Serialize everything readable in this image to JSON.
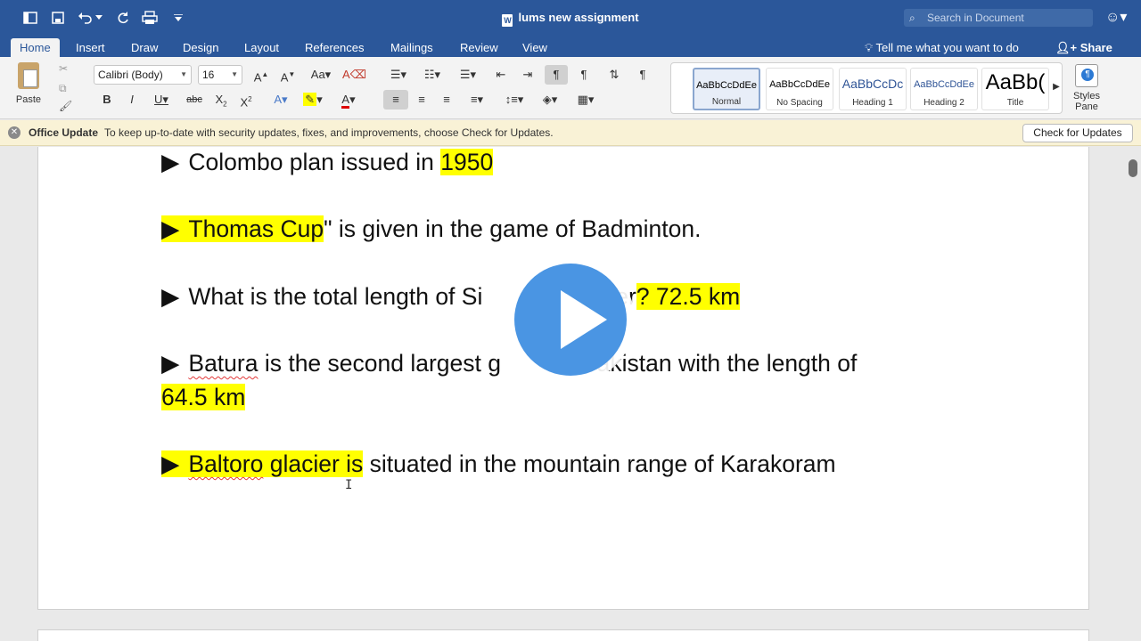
{
  "window": {
    "title": "lums new assignment",
    "search_placeholder": "Search in Document"
  },
  "tabs": [
    {
      "label": "Home"
    },
    {
      "label": "Insert"
    },
    {
      "label": "Draw"
    },
    {
      "label": "Design"
    },
    {
      "label": "Layout"
    },
    {
      "label": "References"
    },
    {
      "label": "Mailings"
    },
    {
      "label": "Review"
    },
    {
      "label": "View"
    }
  ],
  "tell_me": "Tell me what you want to do",
  "share_label": "Share",
  "ribbon": {
    "paste_label": "Paste",
    "font_name": "Calibri (Body)",
    "font_size": "16",
    "styles": [
      {
        "preview": "AaBbCcDdEe",
        "name": "Normal"
      },
      {
        "preview": "AaBbCcDdEe",
        "name": "No Spacing"
      },
      {
        "preview": "AaBbCcDc",
        "name": "Heading 1"
      },
      {
        "preview": "AaBbCcDdEe",
        "name": "Heading 2"
      },
      {
        "preview": "AaBb(",
        "name": "Title"
      }
    ],
    "styles_pane_label_1": "Styles",
    "styles_pane_label_2": "Pane"
  },
  "update_bar": {
    "title": "Office Update",
    "message": "To keep up-to-date with security updates, fixes, and improvements, choose Check for Updates.",
    "button": "Check for Updates"
  },
  "document": {
    "arrow": "▶",
    "line1_text": "Colombo plan issued in ",
    "line1_hl": "1950",
    "line2_hl": "Thomas Cup",
    "line2_text": "\" is given in the game of Badminton.",
    "line3_text": "What is the total length of Si",
    "line3_mid": "ier",
    "line3_hl": "? 72.5 km",
    "line4_pre": "Batura",
    "line4_text": " is the second largest g",
    "line4_end": "Pakistan with the length of",
    "line4b_hl": "64.5 km",
    "line5_hl_a": "Baltoro",
    "line5_hl_b": " glacier is",
    "line5_text": " situated in the mountain range of Karakoram"
  },
  "colors": {
    "brand": "#2b579a",
    "highlight": "#ffff00",
    "play": "#4a95e3"
  }
}
